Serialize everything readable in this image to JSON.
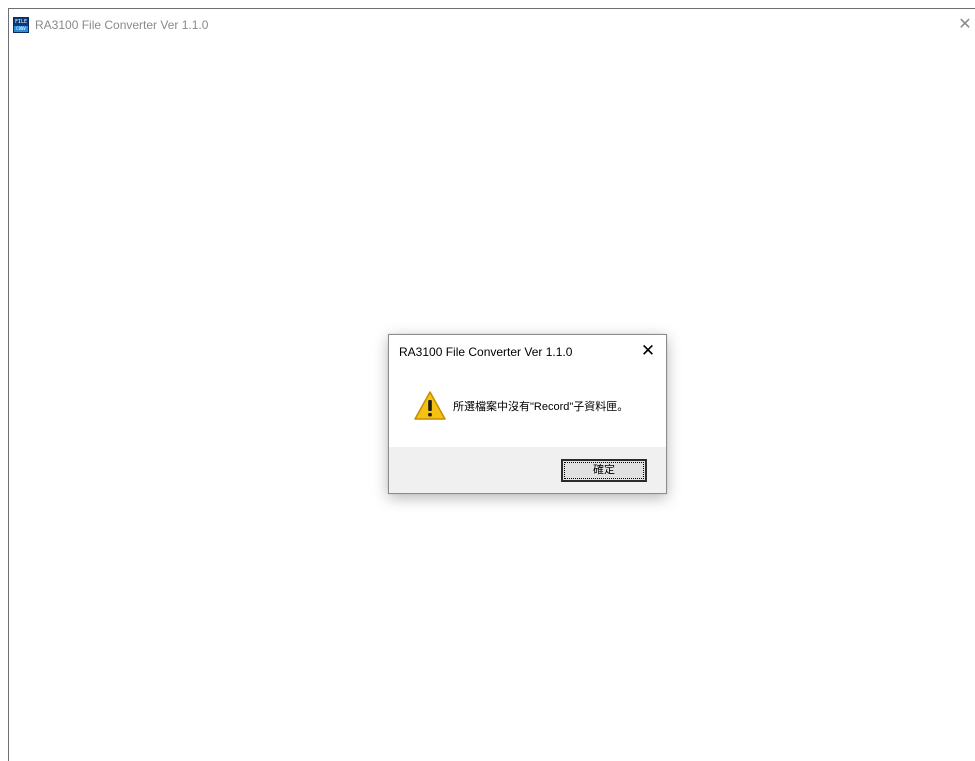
{
  "window": {
    "title": "RA3100 File Converter Ver 1.1.0",
    "icon": "app-icon",
    "icon_top_text": "FILE",
    "icon_bottom_text": "CONV",
    "close_glyph": "✕"
  },
  "dialog": {
    "title": "RA3100 File Converter Ver 1.1.0",
    "close_glyph": "✕",
    "icon": "warning-icon",
    "message": "所選檔案中沒有\"Record\"子資料匣。",
    "ok_label": "確定"
  },
  "colors": {
    "warning_fill": "#f5c211",
    "warning_outline": "#c78c00",
    "button_border": "#2b2b2b",
    "footer_background": "#f0f0f0"
  }
}
